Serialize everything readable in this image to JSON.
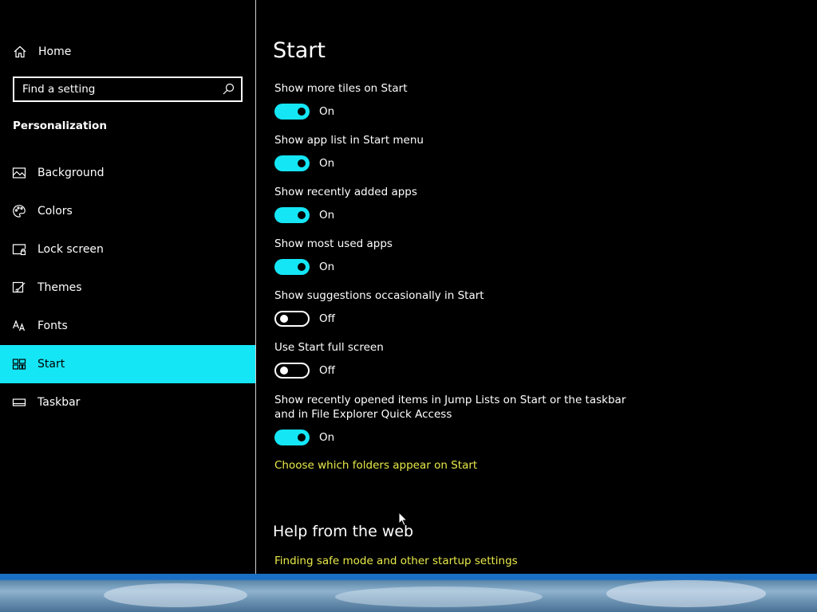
{
  "sidebar": {
    "home_label": "Home",
    "search_placeholder": "Find a setting",
    "section_heading": "Personalization",
    "items": [
      {
        "label": "Background",
        "icon": "picture-icon"
      },
      {
        "label": "Colors",
        "icon": "palette-icon"
      },
      {
        "label": "Lock screen",
        "icon": "lock-screen-icon"
      },
      {
        "label": "Themes",
        "icon": "brush-icon"
      },
      {
        "label": "Fonts",
        "icon": "fonts-icon"
      },
      {
        "label": "Start",
        "icon": "start-tiles-icon",
        "selected": true
      },
      {
        "label": "Taskbar",
        "icon": "taskbar-icon"
      }
    ]
  },
  "main": {
    "title": "Start",
    "settings": [
      {
        "label": "Show more tiles on Start",
        "state": "On"
      },
      {
        "label": "Show app list in Start menu",
        "state": "On"
      },
      {
        "label": "Show recently added apps",
        "state": "On"
      },
      {
        "label": "Show most used apps",
        "state": "On"
      },
      {
        "label": "Show suggestions occasionally in Start",
        "state": "Off"
      },
      {
        "label": "Use Start full screen",
        "state": "Off"
      },
      {
        "label": "Show recently opened items in Jump Lists on Start or the taskbar and in File Explorer Quick Access",
        "state": "On"
      }
    ],
    "folders_link": "Choose which folders appear on Start",
    "help_heading": "Help from the web",
    "help_link": "Finding safe mode and other startup settings"
  },
  "colors": {
    "accent": "#14e6f5",
    "link": "#e8ea4a",
    "background": "#000000",
    "text": "#ffffff"
  }
}
